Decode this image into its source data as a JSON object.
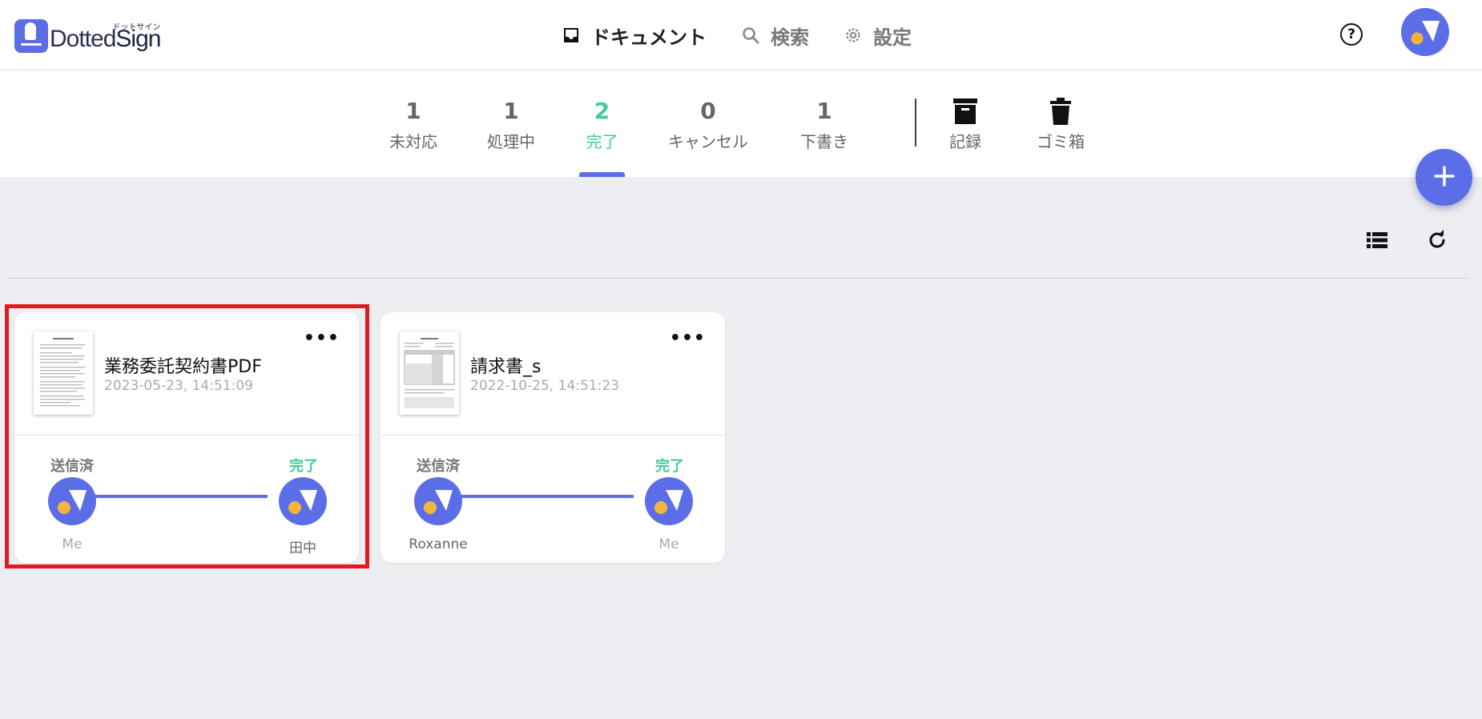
{
  "brand": {
    "name_dotted": "Dotted",
    "name_sign": "Sign",
    "kana": "ドットサイン"
  },
  "nav": {
    "items": [
      {
        "label": "ドキュメント",
        "icon": "inbox-icon",
        "active": true
      },
      {
        "label": "検索",
        "icon": "search-icon",
        "active": false
      },
      {
        "label": "設定",
        "icon": "gear-icon",
        "active": false
      }
    ],
    "help_icon": "?"
  },
  "tabs": [
    {
      "count": "1",
      "label": "未対応",
      "active": false
    },
    {
      "count": "1",
      "label": "処理中",
      "active": false
    },
    {
      "count": "2",
      "label": "完了",
      "active": true
    },
    {
      "count": "0",
      "label": "キャンセル",
      "active": false
    },
    {
      "count": "1",
      "label": "下書き",
      "active": false
    }
  ],
  "tools": [
    {
      "label": "記録",
      "icon": "archive-icon"
    },
    {
      "label": "ゴミ箱",
      "icon": "trash-icon"
    }
  ],
  "fab": {
    "icon": "plus-icon"
  },
  "view_tools": {
    "list_icon": "list-view-icon",
    "refresh_icon": "refresh-icon"
  },
  "documents": [
    {
      "title": "業務委託契約書PDF",
      "date": "2023-05-23, 14:51:09",
      "more": "•••",
      "stage_sent": "送信済",
      "stage_done": "完了",
      "from": "Me",
      "to": "田中",
      "highlighted": true
    },
    {
      "title": "請求書_s",
      "date": "2022-10-25, 14:51:23",
      "more": "•••",
      "stage_sent": "送信済",
      "stage_done": "完了",
      "from": "Roxanne",
      "to": "Me",
      "highlighted": false
    }
  ],
  "colors": {
    "accent": "#5b6ee8",
    "success": "#3fcc9a",
    "avatar_dot": "#f2b53a",
    "highlight": "#e3191e",
    "background": "#edeef2"
  }
}
